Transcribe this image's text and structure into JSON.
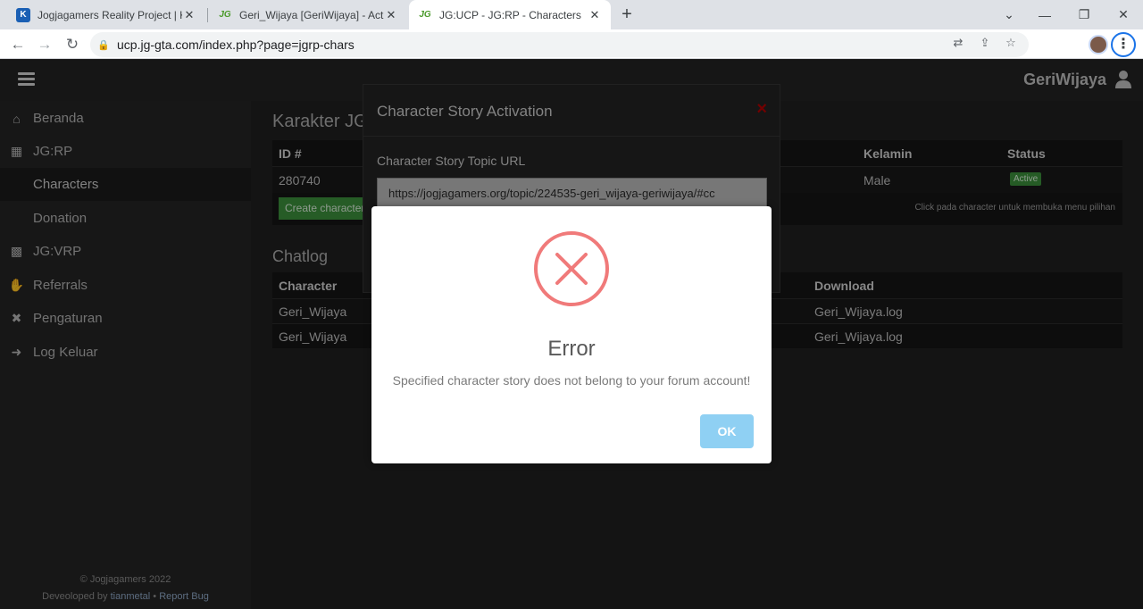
{
  "browser": {
    "tabs": [
      {
        "title": "Jogjagamers Reality Project | KAS",
        "favicon": "K"
      },
      {
        "title": "Geri_Wijaya [GeriWijaya] - Active",
        "favicon": "JG"
      },
      {
        "title": "JG:UCP - JG:RP - Characters",
        "favicon": "JG"
      }
    ],
    "url": "ucp.jg-gta.com/index.php?page=jgrp-chars"
  },
  "header": {
    "username": "GeriWijaya"
  },
  "sidebar": {
    "items": [
      {
        "label": "Beranda",
        "icon": "home-icon"
      },
      {
        "label": "JG:RP",
        "icon": "jgrp-icon"
      },
      {
        "label": "Characters",
        "icon": ""
      },
      {
        "label": "Donation",
        "icon": ""
      },
      {
        "label": "JG:VRP",
        "icon": "jgvrp-icon"
      },
      {
        "label": "Referrals",
        "icon": "handshake-icon"
      },
      {
        "label": "Pengaturan",
        "icon": "wrench-icon"
      },
      {
        "label": "Log Keluar",
        "icon": "logout-icon"
      }
    ],
    "footer": {
      "copyright": "© Jogjagamers 2022",
      "developed_by": "Deveoloped by",
      "developer": "tianmetal",
      "separator": "•",
      "report": "Report Bug"
    }
  },
  "main": {
    "title": "Karakter JG:Roleplay",
    "characters_table": {
      "headers": [
        "ID #",
        "Kelamin",
        "Status"
      ],
      "row": {
        "id": "280740",
        "gender": "Male",
        "status": "Active"
      }
    },
    "create_button": "Create character",
    "hint": "Click pada character untuk membuka menu pilihan",
    "chatlog": {
      "title": "Chatlog",
      "headers": [
        "Character",
        "Download"
      ],
      "rows": [
        {
          "character": "Geri_Wijaya",
          "download": "Geri_Wijaya.log"
        },
        {
          "character": "Geri_Wijaya",
          "download": "Geri_Wijaya.log"
        }
      ]
    }
  },
  "story_modal": {
    "title": "Character Story Activation",
    "close": "×",
    "label": "Character Story Topic URL",
    "value": "https://jogjagamers.org/topic/224535-geri_wijaya-geriwijaya/#cc"
  },
  "error_dialog": {
    "title": "Error",
    "message": "Specified character story does not belong to your forum account!",
    "ok": "OK"
  }
}
